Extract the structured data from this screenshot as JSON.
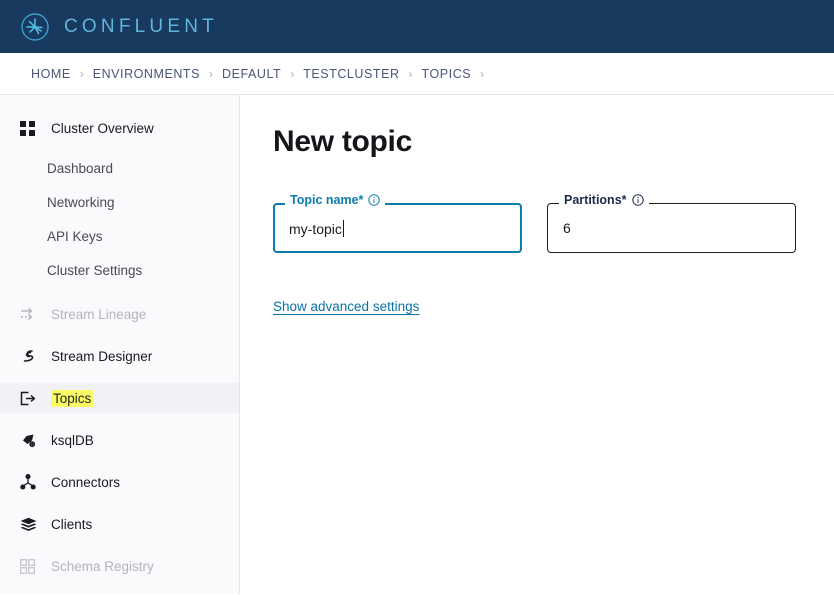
{
  "navbar": {
    "logo_icon": "confluent-starburst-logo-icon",
    "brand": "CONFLUENT",
    "bg_color": "#173A5E",
    "brand_color": "#63B3DE"
  },
  "breadcrumb": {
    "separator": "›",
    "items": [
      {
        "label": "HOME"
      },
      {
        "label": "ENVIRONMENTS"
      },
      {
        "label": "DEFAULT"
      },
      {
        "label": "TESTCLUSTER"
      },
      {
        "label": "TOPICS"
      }
    ],
    "trailing_separator": "›"
  },
  "sidebar": {
    "items": [
      {
        "label": "Cluster Overview",
        "icon": "grid-squares-icon",
        "type": "top",
        "state": "normal"
      },
      {
        "label": "Dashboard",
        "type": "sub"
      },
      {
        "label": "Networking",
        "type": "sub"
      },
      {
        "label": "API Keys",
        "type": "sub"
      },
      {
        "label": "Cluster Settings",
        "type": "sub"
      },
      {
        "label": "Stream Lineage",
        "icon": "arrows-right-icon",
        "type": "top",
        "state": "disabled"
      },
      {
        "label": "Stream Designer",
        "icon": "stream-flow-icon",
        "type": "top",
        "state": "normal"
      },
      {
        "label": "Topics",
        "icon": "topics-arrow-out-icon",
        "type": "top",
        "state": "active-highlighted"
      },
      {
        "label": "ksqlDB",
        "icon": "ksqldb-pen-icon",
        "type": "top",
        "state": "normal"
      },
      {
        "label": "Connectors",
        "icon": "connectors-hub-icon",
        "type": "top",
        "state": "normal"
      },
      {
        "label": "Clients",
        "icon": "clients-stack-icon",
        "type": "top",
        "state": "normal"
      },
      {
        "label": "Schema Registry",
        "icon": "schema-grid-icon",
        "type": "top",
        "state": "disabled"
      }
    ],
    "highlight_color": "#FAFA64",
    "active_row_bg": "#F1F2F6"
  },
  "main": {
    "title": "New topic",
    "fields": {
      "topic_name": {
        "label": "Topic name*",
        "info_icon": "info-circle-icon",
        "value": "my-topic",
        "placeholder": "",
        "focused": true,
        "focus_color": "#0B7CAB"
      },
      "partitions": {
        "label": "Partitions*",
        "info_icon": "info-circle-icon",
        "value": "6",
        "placeholder": "",
        "focused": false
      }
    },
    "advanced_link": "Show advanced settings",
    "link_color": "#0B72A8"
  }
}
